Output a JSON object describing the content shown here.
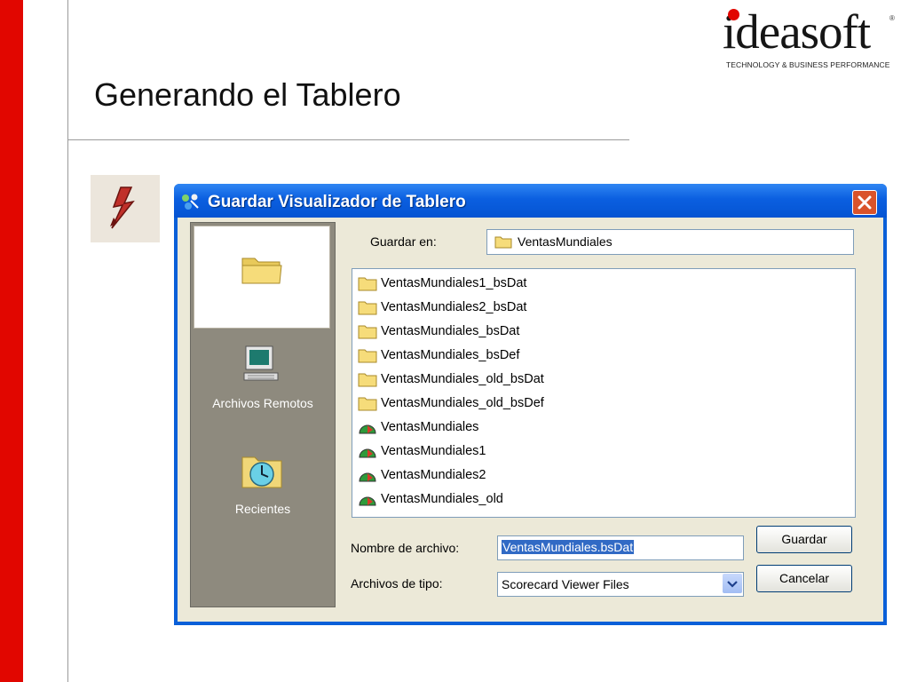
{
  "slide": {
    "title": "Generando el Tablero",
    "logo": {
      "wordmark": "ideasoft",
      "tagline": "TECHNOLOGY & BUSINESS PERFORMANCE",
      "registered": "®"
    },
    "accent_color": "#e10600"
  },
  "dialog": {
    "title": "Guardar Visualizador de Tablero",
    "save_in_label": "Guardar en:",
    "save_in_value": "VentasMundiales",
    "places": [
      {
        "label": "",
        "icon": "folder-icon",
        "selected": true
      },
      {
        "label": "Archivos Remotos",
        "icon": "computer-icon"
      },
      {
        "label": "Recientes",
        "icon": "recent-folder-icon"
      }
    ],
    "files": [
      {
        "name": "VentasMundiales1_bsDat",
        "icon": "folder-icon"
      },
      {
        "name": "VentasMundiales2_bsDat",
        "icon": "folder-icon"
      },
      {
        "name": "VentasMundiales_bsDat",
        "icon": "folder-icon"
      },
      {
        "name": "VentasMundiales_bsDef",
        "icon": "folder-icon"
      },
      {
        "name": "VentasMundiales_old_bsDat",
        "icon": "folder-icon"
      },
      {
        "name": "VentasMundiales_old_bsDef",
        "icon": "folder-icon"
      },
      {
        "name": "VentasMundiales",
        "icon": "scorecard-icon"
      },
      {
        "name": "VentasMundiales1",
        "icon": "scorecard-icon"
      },
      {
        "name": "VentasMundiales2",
        "icon": "scorecard-icon"
      },
      {
        "name": "VentasMundiales_old",
        "icon": "scorecard-icon"
      }
    ],
    "filename_label": "Nombre de archivo:",
    "filename_value": "VentasMundiales.bsDat",
    "filetype_label": "Archivos de tipo:",
    "filetype_value": "Scorecard Viewer Files",
    "save_button": "Guardar",
    "cancel_button": "Cancelar",
    "titlebar_color": "#0b5fe0"
  }
}
